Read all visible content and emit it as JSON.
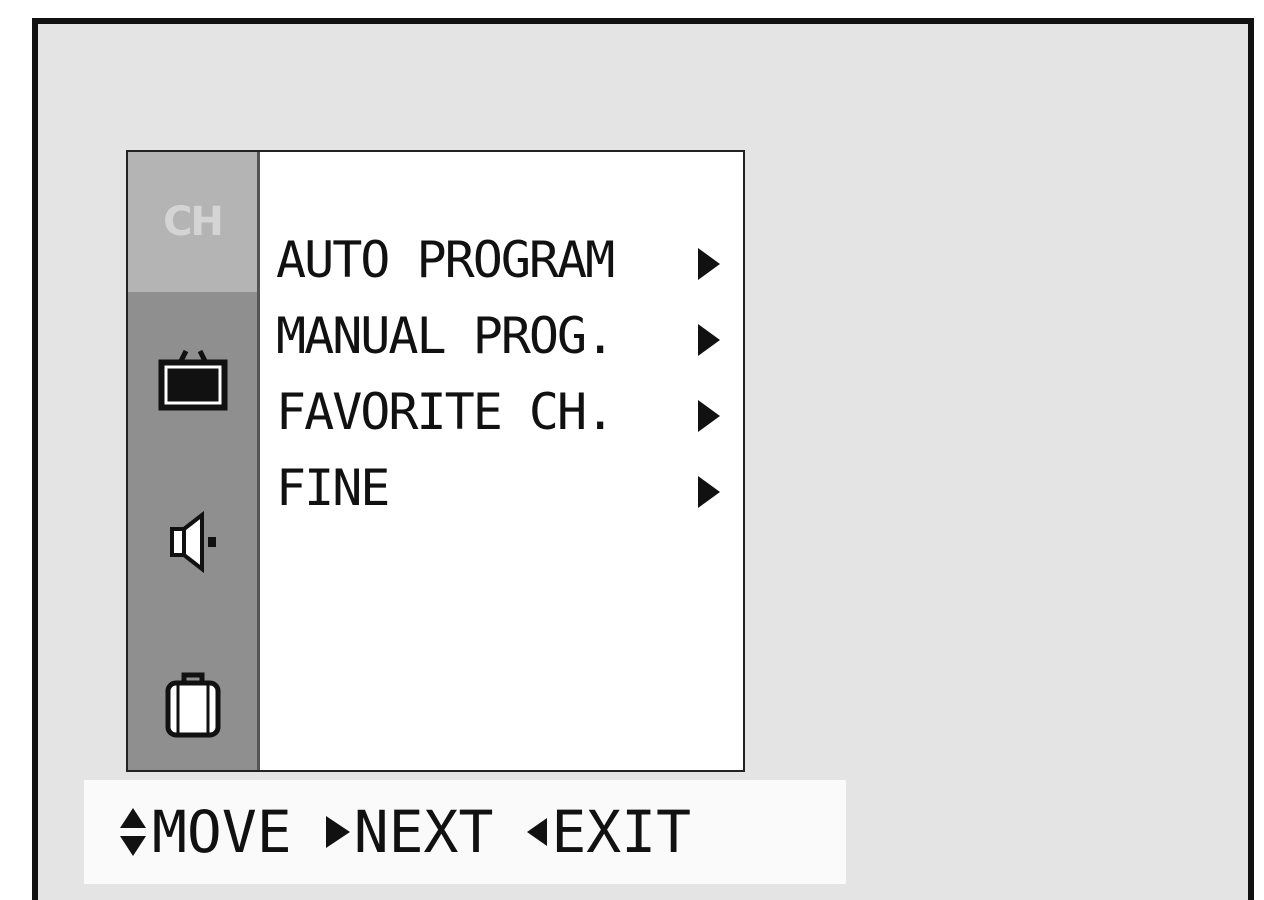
{
  "sidebar": {
    "active_label": "CH",
    "items": [
      {
        "icon": "ch-icon",
        "label": "CH"
      },
      {
        "icon": "picture-icon"
      },
      {
        "icon": "speaker-icon"
      },
      {
        "icon": "lock-icon"
      }
    ]
  },
  "menu": {
    "items": [
      {
        "label": "AUTO PROGRAM"
      },
      {
        "label": "MANUAL PROG."
      },
      {
        "label": "FAVORITE CH."
      },
      {
        "label": "FINE"
      }
    ]
  },
  "help": {
    "move": "MOVE",
    "next": "NEXT",
    "exit": "EXIT"
  },
  "colors": {
    "screen_bg": "#e4e4e4",
    "sidebar_bg": "#8f8f8f",
    "sidebar_active_bg": "#b4b4b4",
    "menu_bg": "#ffffff"
  }
}
